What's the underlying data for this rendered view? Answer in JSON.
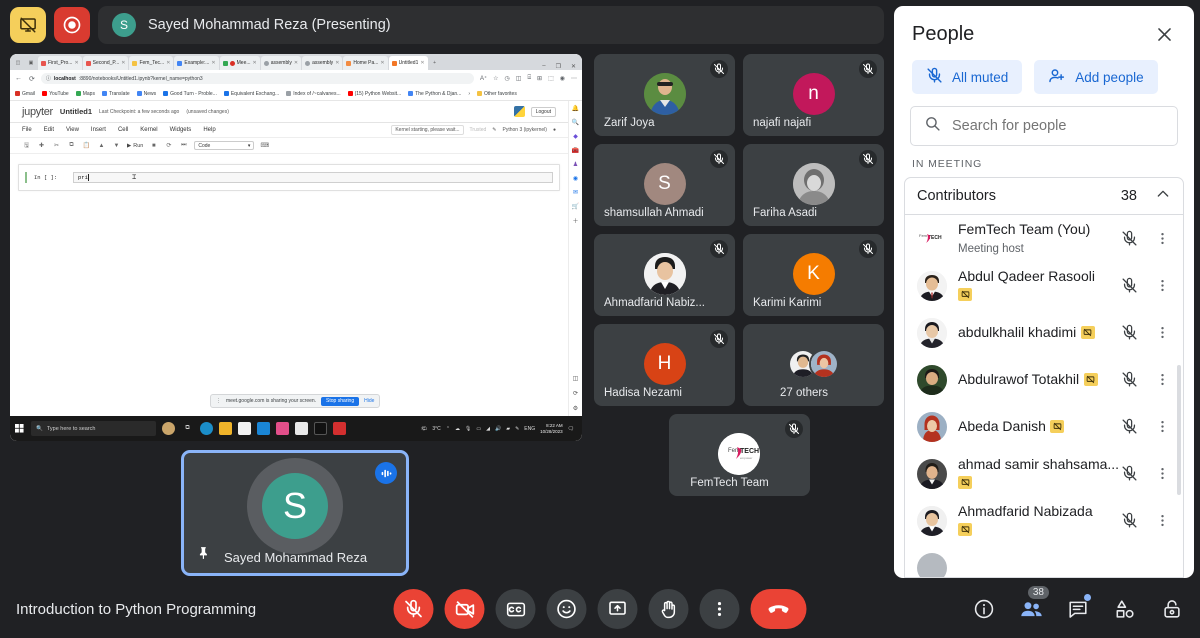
{
  "topbar": {
    "present_icon": "presentation-off-icon",
    "record_icon": "record-icon",
    "presenter_initial": "S",
    "presenter_label": "Sayed Mohammad Reza (Presenting)"
  },
  "shared_screen": {
    "browser_tabs": [
      {
        "label": "First_Pro...",
        "color": "#e8554e"
      },
      {
        "label": "Second_P...",
        "color": "#e8554e"
      },
      {
        "label": "Fem_Tec...",
        "color": "#f4c242"
      },
      {
        "label": "Example:...",
        "color": "#4285f4"
      },
      {
        "label": "Mee...",
        "color": "#34a853"
      },
      {
        "label": "assembly",
        "color": "#9aa0a6"
      },
      {
        "label": "assembly",
        "color": "#9aa0a6"
      },
      {
        "label": "Home Pa...",
        "color": "#f28b42"
      },
      {
        "label": "Untitled1",
        "color": "#f37726",
        "active": true
      }
    ],
    "new_tab_label": "+",
    "window_controls": [
      "–",
      "❐",
      "✕"
    ],
    "url_host": "localhost",
    "url_path": ":8890/notebooks/Untitled1.ipynb?kernel_name=python3",
    "bookmarks": [
      {
        "label": "Gmail",
        "color": "#d93025"
      },
      {
        "label": "YouTube",
        "color": "#ff0000"
      },
      {
        "label": "Maps",
        "color": "#34a853"
      },
      {
        "label": "Translate",
        "color": "#4285f4"
      },
      {
        "label": "News",
        "color": "#4285f4"
      },
      {
        "label": "Good Turn - Proble...",
        "color": "#1a73e8"
      },
      {
        "label": "Equivalent Exchang...",
        "color": "#1a73e8"
      },
      {
        "label": "Index of /~calvanes...",
        "color": "#9aa0a6"
      },
      {
        "label": "(15) Python Websit...",
        "color": "#ff0000"
      },
      {
        "label": "The Python & Djan...",
        "color": "#4285f4"
      }
    ],
    "bookmarks_overflow": "›",
    "other_favorites": "Other favorites",
    "jupyter": {
      "logo": "jupyter",
      "notebook_title": "Untitled1",
      "checkpoint": "Last Checkpoint: a few seconds ago",
      "unsaved": "(unsaved changes)",
      "logout": "Logout",
      "menu": [
        "File",
        "Edit",
        "View",
        "Insert",
        "Cell",
        "Kernel",
        "Widgets",
        "Help"
      ],
      "kernel_status": "Kernel starting, please wait...",
      "trusted": "Trusted",
      "kernel_name": "Python 3 (ipykernel)",
      "run_label": "Run",
      "cell_type": "Code",
      "cell_prompt": "In [ ]:",
      "cell_code": "pri"
    },
    "share_toast": {
      "message": "meet.google.com is sharing your screen.",
      "stop_label": "Stop sharing",
      "hide_label": "Hide"
    },
    "taskbar": {
      "search_placeholder": "Type here to search",
      "temperature": "3°C",
      "language": "ENG",
      "time": "8:22 AM",
      "date": "10/28/2023"
    }
  },
  "tiles": [
    {
      "name": "Zarif Joya",
      "kind": "photo",
      "photo": "man-sunglasses",
      "muted": true
    },
    {
      "name": "najafi najafi",
      "kind": "initial",
      "initial": "n",
      "color": "#c2185b",
      "muted": true
    },
    {
      "name": "shamsullah Ahmadi",
      "kind": "initial",
      "initial": "S",
      "color": "#a1887f",
      "muted": true
    },
    {
      "name": "Fariha Asadi",
      "kind": "photo",
      "photo": "greyscale-portrait",
      "muted": true
    },
    {
      "name": "Ahmadfarid Nabiz...",
      "kind": "photo",
      "photo": "man-suit",
      "muted": true
    },
    {
      "name": "Karimi Karimi",
      "kind": "initial",
      "initial": "K",
      "color": "#f57c00",
      "muted": true
    },
    {
      "name": "Hadisa Nezami",
      "kind": "initial",
      "initial": "H",
      "color": "#d84315",
      "muted": true
    },
    {
      "name": "27 others",
      "kind": "others",
      "muted": false
    },
    {
      "name": "FemTech Team",
      "kind": "logo",
      "muted": true
    }
  ],
  "selfview": {
    "initial": "S",
    "name": "Sayed Mohammad Reza",
    "pin_icon": "pin-icon",
    "speaking_icon": "audio-levels-icon"
  },
  "bottombar": {
    "meeting_title": "Introduction to Python Programming",
    "controls": [
      {
        "name": "mic-off-button",
        "icon": "mic-off-icon",
        "state": "danger"
      },
      {
        "name": "camera-off-button",
        "icon": "camera-off-icon",
        "state": "danger"
      },
      {
        "name": "captions-button",
        "icon": "closed-captions-icon",
        "state": "normal"
      },
      {
        "name": "reactions-button",
        "icon": "emoji-icon",
        "state": "normal"
      },
      {
        "name": "present-button",
        "icon": "present-screen-icon",
        "state": "normal"
      },
      {
        "name": "raise-hand-button",
        "icon": "raise-hand-icon",
        "state": "normal"
      },
      {
        "name": "more-options-button",
        "icon": "more-vertical-icon",
        "state": "normal"
      },
      {
        "name": "leave-call-button",
        "icon": "hangup-icon",
        "state": "hangup"
      }
    ],
    "right_controls": [
      {
        "name": "meeting-details-button",
        "icon": "info-icon"
      },
      {
        "name": "people-button",
        "icon": "people-icon",
        "badge": "38",
        "active": true
      },
      {
        "name": "chat-button",
        "icon": "chat-icon",
        "dot": true
      },
      {
        "name": "activities-button",
        "icon": "activities-icon"
      },
      {
        "name": "host-controls-button",
        "icon": "lock-icon"
      }
    ]
  },
  "people_panel": {
    "title": "People",
    "close_icon": "close-icon",
    "all_muted_label": "All muted",
    "all_muted_icon": "mic-off-icon",
    "add_people_label": "Add people",
    "add_people_icon": "person-add-icon",
    "search_placeholder": "Search for people",
    "search_value": "",
    "search_icon": "search-icon",
    "section_label": "IN MEETING",
    "group_label": "Contributors",
    "group_count": "38",
    "collapse_icon": "chevron-up-icon",
    "participants": [
      {
        "name": "FemTech Team (You)",
        "sub": "Meeting host",
        "avatar": "femtech-logo",
        "muted": true,
        "badge": false
      },
      {
        "name": "Abdul Qadeer Rasooli",
        "sub": "",
        "avatar": "man-tie",
        "muted": true,
        "badge": true
      },
      {
        "name": "abdulkhalil khadimi",
        "sub": "",
        "avatar": "man-dark-suit",
        "muted": true,
        "badge": true
      },
      {
        "name": "Abdulrawof Totakhil",
        "sub": "",
        "avatar": "man-green-bg",
        "muted": true,
        "badge": true
      },
      {
        "name": "Abeda Danish",
        "sub": "",
        "avatar": "woman-hijab",
        "muted": true,
        "badge": true
      },
      {
        "name": "ahmad samir shahsama...",
        "sub": "",
        "avatar": "man-white-shirt",
        "muted": true,
        "badge": true
      },
      {
        "name": "Ahmadfarid Nabizada",
        "sub": "",
        "avatar": "man-suit",
        "muted": true,
        "badge": true
      }
    ]
  },
  "colors": {
    "app_bg": "#202124",
    "tile_bg": "#3c4043",
    "accent_blue": "#8ab4f8",
    "danger_red": "#ea4335",
    "panel_white": "#ffffff",
    "chip_blue": "#e8f0fe"
  }
}
